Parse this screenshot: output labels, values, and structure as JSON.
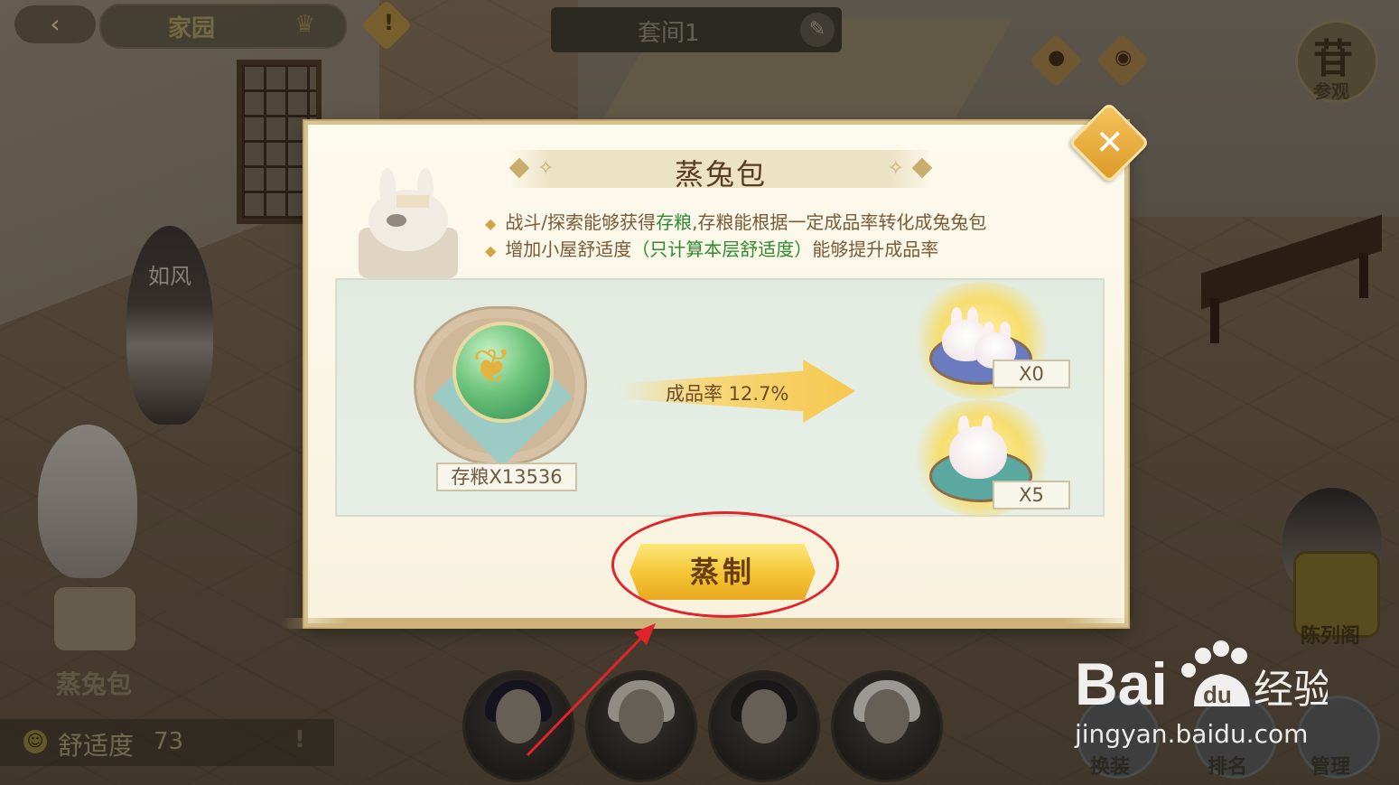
{
  "hud": {
    "home_label": "家园",
    "room_label": "套间1",
    "visit_label": "参观",
    "visit_glyph": "苷"
  },
  "dialog": {
    "title": "蒸兔包",
    "desc_line1_a": "战斗/探索能够获得",
    "desc_line1_hl": "存粮",
    "desc_line1_b": ",存粮能根据一定成品率转化成兔兔包",
    "desc_line2_a": "增加小屋舒适度",
    "desc_line2_hl": "（只计算本层舒适度）",
    "desc_line2_b": "能够提升成品率",
    "ingredient_label": "存粮X13536",
    "rate_label": "成品率  12.7%",
    "rewards": [
      {
        "count": "X0"
      },
      {
        "count": "X5"
      }
    ],
    "brew_button": "蒸制",
    "close_icon": "close-icon"
  },
  "bottom": {
    "bun_label": "蒸兔包",
    "comfort_label": "舒适度",
    "comfort_value": "73",
    "right_buttons": [
      {
        "label": "换装"
      },
      {
        "label": "排名"
      },
      {
        "label": "管理"
      }
    ],
    "museum_label": "陈列阁"
  },
  "characters": {
    "name_tag": "如风"
  },
  "watermark": {
    "url": "jingyan.baidu.com"
  },
  "colors": {
    "accent_gold": "#f4c534",
    "highlight_green": "#2f8a2f",
    "annotation_red": "#e0242a"
  }
}
